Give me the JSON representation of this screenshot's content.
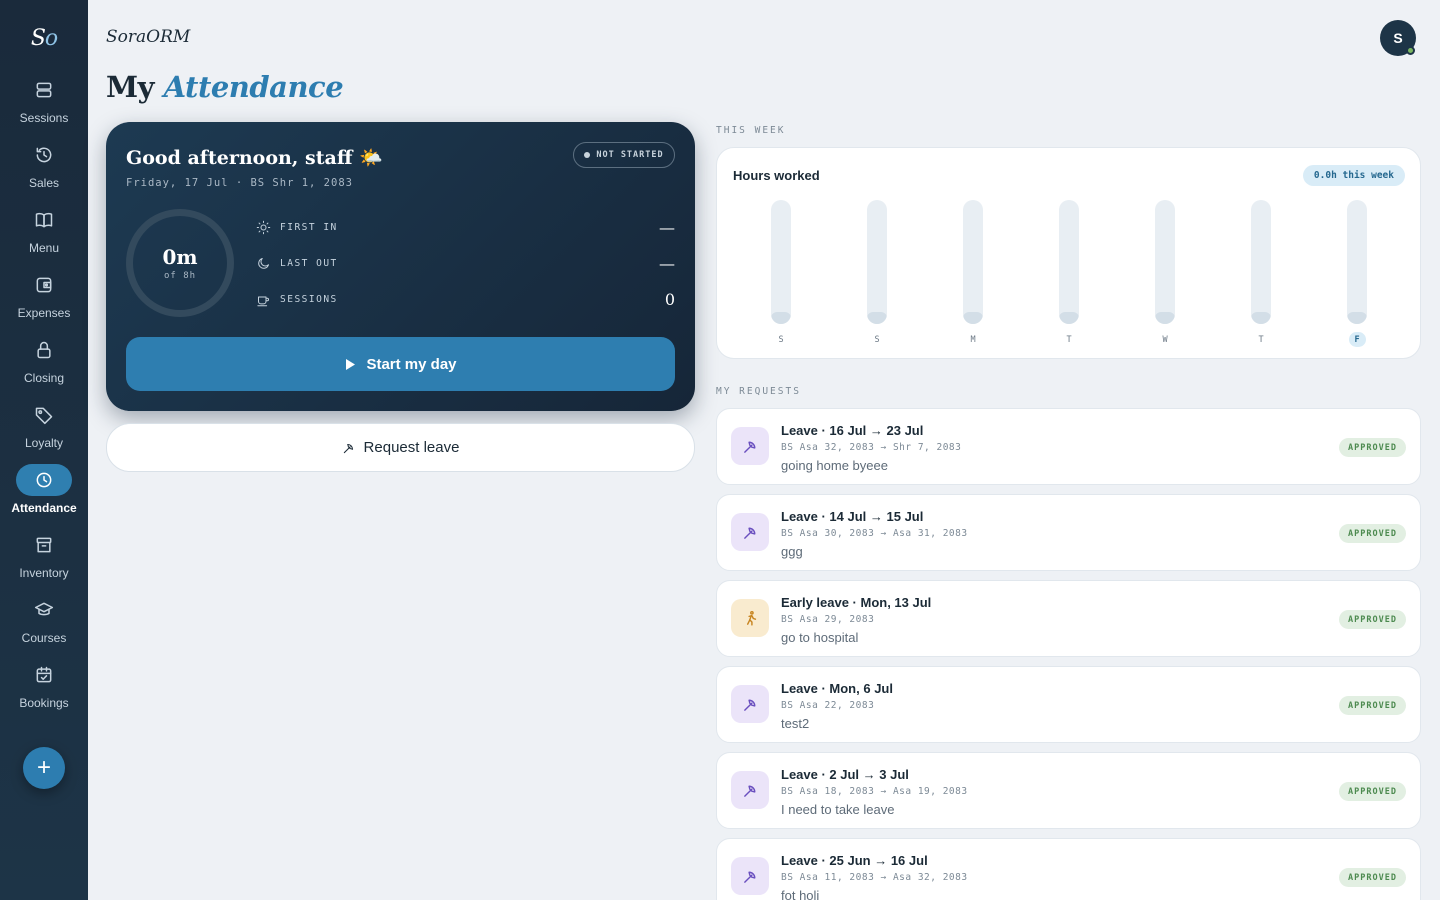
{
  "app": {
    "logo_s": "S",
    "logo_o": "o",
    "brand": "SoraORM",
    "avatar_initial": "S"
  },
  "sidebar": {
    "items": [
      {
        "label": "Sessions",
        "icon": "sessions-icon",
        "active": false
      },
      {
        "label": "Sales",
        "icon": "history-icon",
        "active": false
      },
      {
        "label": "Menu",
        "icon": "book-icon",
        "active": false
      },
      {
        "label": "Expenses",
        "icon": "wallet-icon",
        "active": false
      },
      {
        "label": "Closing",
        "icon": "lock-icon",
        "active": false
      },
      {
        "label": "Loyalty",
        "icon": "tag-icon",
        "active": false
      },
      {
        "label": "Attendance",
        "icon": "clock-icon",
        "active": true
      },
      {
        "label": "Inventory",
        "icon": "archive-icon",
        "active": false
      },
      {
        "label": "Courses",
        "icon": "graduation-cap-icon",
        "active": false
      },
      {
        "label": "Bookings",
        "icon": "calendar-check-icon",
        "active": false
      }
    ],
    "fab_label": "+"
  },
  "page": {
    "title_plain": "My",
    "title_accent": "Attendance"
  },
  "today": {
    "greeting": "Good afternoon, staff 🌤️",
    "date_line": "Friday, 17 Jul  ·  BS Shr 1, 2083",
    "status": "NOT STARTED",
    "progress_value": "0m",
    "progress_target": "of 8h",
    "progress_fraction": 0,
    "first_in_label": "FIRST IN",
    "first_in_value": "—",
    "last_out_label": "LAST OUT",
    "last_out_value": "—",
    "sessions_label": "SESSIONS",
    "sessions_value": "0",
    "start_button": "Start my day"
  },
  "request_leave_button": "Request leave",
  "week": {
    "section_label": "THIS WEEK",
    "title": "Hours worked",
    "badge": "0.0h this week",
    "days": [
      {
        "label": "S",
        "hours": 0,
        "today": false
      },
      {
        "label": "S",
        "hours": 0,
        "today": false
      },
      {
        "label": "M",
        "hours": 0,
        "today": false
      },
      {
        "label": "T",
        "hours": 0,
        "today": false
      },
      {
        "label": "W",
        "hours": 0,
        "today": false
      },
      {
        "label": "T",
        "hours": 0,
        "today": false
      },
      {
        "label": "F",
        "hours": 0,
        "today": true
      }
    ],
    "max_hours": 8
  },
  "requests": {
    "section_label": "MY REQUESTS",
    "items": [
      {
        "kind": "leave",
        "title": "Leave · 16 Jul → 23 Jul",
        "bs": "BS Asa 32, 2083 → Shr 7, 2083",
        "note": "going home byeee",
        "status": "APPROVED"
      },
      {
        "kind": "leave",
        "title": "Leave · 14 Jul → 15 Jul",
        "bs": "BS Asa 30, 2083 → Asa 31, 2083",
        "note": "ggg",
        "status": "APPROVED"
      },
      {
        "kind": "early",
        "title": "Early leave · Mon, 13 Jul",
        "bs": "BS Asa 29, 2083",
        "note": "go to hospital",
        "status": "APPROVED"
      },
      {
        "kind": "leave",
        "title": "Leave · Mon, 6 Jul",
        "bs": "BS Asa 22, 2083",
        "note": "test2",
        "status": "APPROVED"
      },
      {
        "kind": "leave",
        "title": "Leave · 2 Jul → 3 Jul",
        "bs": "BS Asa 18, 2083 → Asa 19, 2083",
        "note": "I need to take leave",
        "status": "APPROVED"
      },
      {
        "kind": "leave",
        "title": "Leave · 25 Jun → 16 Jul",
        "bs": "BS Asa 11, 2083 → Asa 32, 2083",
        "note": "fot holi",
        "status": "APPROVED"
      }
    ]
  }
}
